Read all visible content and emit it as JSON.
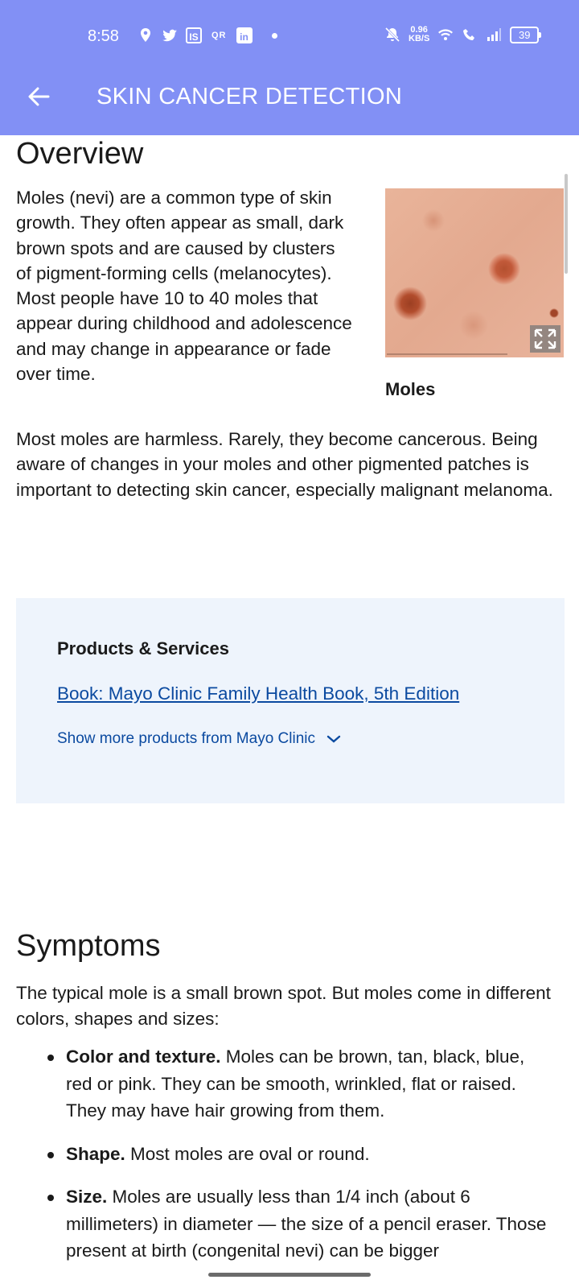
{
  "status_bar": {
    "time": "8:58",
    "app_icons": [
      "location-icon",
      "twitter-icon",
      "is-app-icon",
      "qr-icon",
      "linkedin-icon"
    ],
    "is_label": "IS",
    "qr_label": "QR",
    "linkedin_label": "in",
    "network_speed_value": "0.96",
    "network_speed_unit": "KB/S",
    "battery": "39"
  },
  "app_bar": {
    "title": "SKIN CANCER DETECTION",
    "background": "#8290f5"
  },
  "overview": {
    "heading": "Overview",
    "paragraph1": "Moles (nevi) are a common type of skin growth. They often appear as small, dark brown spots and are caused by clusters of pigment-forming cells (melanocytes). Most people have 10 to 40 moles that appear during childhood and adolescence and may change in appearance or fade over time.",
    "figure_caption": "Moles",
    "paragraph2": "Most moles are harmless. Rarely, they become cancerous. Being aware of changes in your moles and other pigmented patches is important to detecting skin cancer, especially malignant melanoma."
  },
  "products": {
    "title": "Products & Services",
    "link": "Book: Mayo Clinic Family Health Book, 5th Edition",
    "show_more": "Show more products from Mayo Clinic",
    "background": "#eef4fc",
    "link_color": "#0b4aa0"
  },
  "symptoms": {
    "heading": "Symptoms",
    "intro": "The typical mole is a small brown spot. But moles come in different colors, shapes and sizes:",
    "items": [
      {
        "bold": "Color and texture.",
        "text": " Moles can be brown, tan, black, blue, red or pink. They can be smooth, wrinkled, flat or raised. They may have hair growing from them."
      },
      {
        "bold": "Shape.",
        "text": " Most moles are oval or round."
      },
      {
        "bold": "Size.",
        "text": " Moles are usually less than 1/4 inch (about 6 millimeters) in diameter — the size of a pencil eraser. Those present at birth (congenital nevi) can be bigger"
      }
    ]
  }
}
